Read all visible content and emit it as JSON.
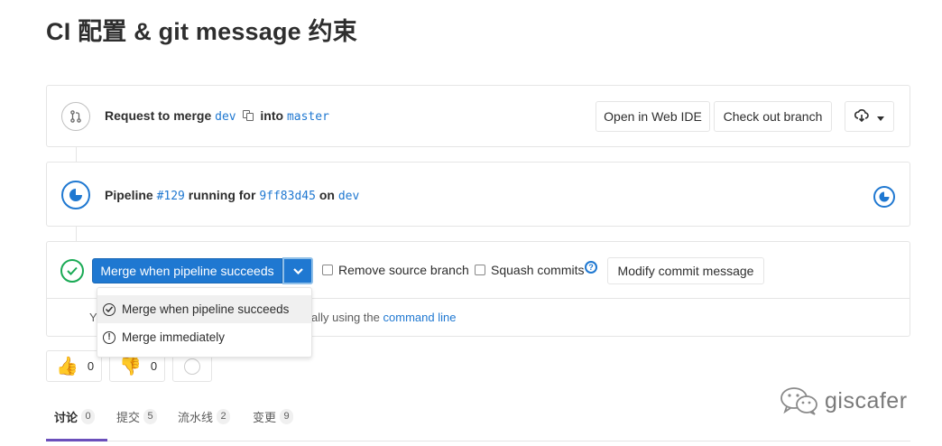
{
  "page": {
    "title": "CI 配置 & git message 约束"
  },
  "request_bar": {
    "request_label": "Request to merge",
    "source_branch": "dev",
    "into_label": "into",
    "target_branch": "master",
    "open_ide_label": "Open in Web IDE",
    "checkout_label": "Check out branch"
  },
  "pipeline": {
    "label": "Pipeline",
    "id": "#129",
    "status_text": "running for",
    "commit": "9ff83d45",
    "on_label": "on",
    "branch": "dev"
  },
  "merge_widget": {
    "merge_button_label": "Merge when pipeline succeeds",
    "remove_source_label": "Remove source branch",
    "squash_label": "Squash commits",
    "help_glyph": "?",
    "modify_commit_label": "Modify commit message",
    "cmd_prefix": "Y",
    "cmd_text": "ally using the",
    "cmd_link": "command line",
    "dropdown": [
      {
        "label": "Merge when pipeline succeeds",
        "icon": "check-circle-icon"
      },
      {
        "label": "Merge immediately",
        "icon": "warning-circle-icon"
      }
    ]
  },
  "awards": {
    "thumbs_up_count": "0",
    "thumbs_down_count": "0"
  },
  "tabs": [
    {
      "label": "讨论",
      "count": "0"
    },
    {
      "label": "提交",
      "count": "5"
    },
    {
      "label": "流水线",
      "count": "2"
    },
    {
      "label": "变更",
      "count": "9"
    }
  ],
  "watermark": {
    "text": "giscafer"
  },
  "colors": {
    "link": "#1f78d1",
    "success": "#1aaa55",
    "active_tab": "#6b4fbb"
  }
}
